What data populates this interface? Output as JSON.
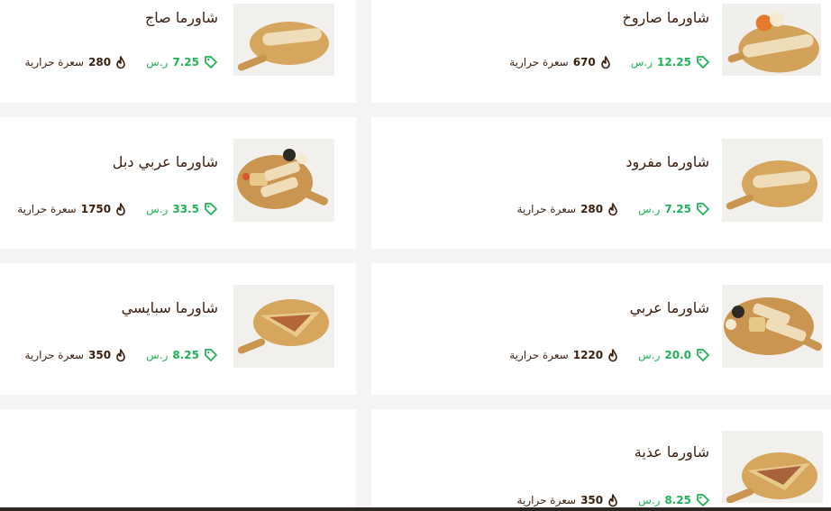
{
  "currency": "ر.س",
  "calories_label": "سعرة حرارية",
  "colors": {
    "price": "#20b35a",
    "text": "#3b1f0e",
    "card": "#ffffff",
    "background": "#f5f4f2"
  },
  "icons": {
    "price": "price-tag-icon",
    "calories": "flame-icon"
  },
  "items": [
    {
      "name": "شاورما صاروخ",
      "price": "12.25",
      "calories": "670",
      "image": "rolled-shawarma-with-dips-on-board"
    },
    {
      "name": "شاورما صاج",
      "price": "7.25",
      "calories": "280",
      "image": "rolled-shawarma-on-board"
    },
    {
      "name": "شاورما مفرود",
      "price": "7.25",
      "calories": "280",
      "image": "rolled-shawarma-on-board"
    },
    {
      "name": "شاورما عربي دبل",
      "price": "33.5",
      "calories": "1750",
      "image": "arabic-shawarma-platter-with-fries"
    },
    {
      "name": "شاورما عربي",
      "price": "20.0",
      "calories": "1220",
      "image": "arabic-shawarma-platter-with-fries"
    },
    {
      "name": "شاورما سبايسي",
      "price": "8.25",
      "calories": "350",
      "image": "open-spicy-shawarma-on-board"
    },
    {
      "name": "شاورما عذية",
      "price": "8.25",
      "calories": "350",
      "image": "open-shawarma-on-board"
    }
  ]
}
